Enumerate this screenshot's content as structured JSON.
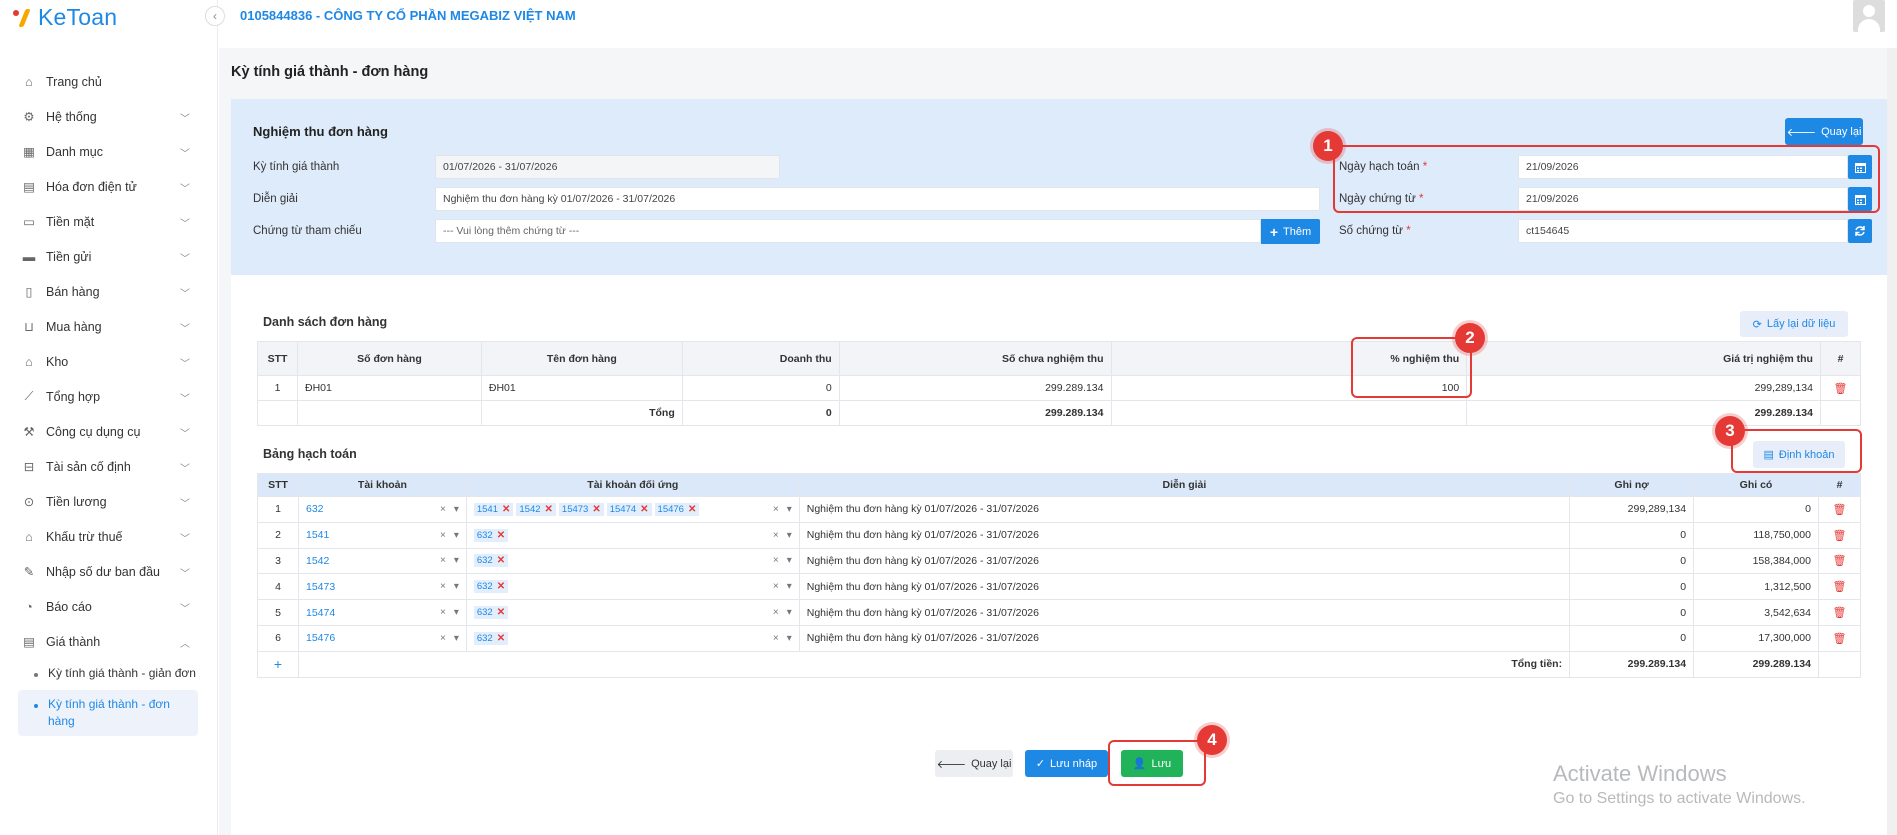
{
  "app": {
    "logo": "KeToan",
    "company": "0105844836 - CÔNG TY CỔ PHẦN MEGABIZ VIỆT NAM"
  },
  "sidebar": {
    "items": [
      {
        "label": "Trang chủ",
        "icon": "home-icon",
        "chevron": false
      },
      {
        "label": "Hệ thống",
        "icon": "gear-icon",
        "chevron": true
      },
      {
        "label": "Danh mục",
        "icon": "grid-icon",
        "chevron": true
      },
      {
        "label": "Hóa đơn điện tử",
        "icon": "invoice-icon",
        "chevron": true
      },
      {
        "label": "Tiền mặt",
        "icon": "cash-icon",
        "chevron": true
      },
      {
        "label": "Tiền gửi",
        "icon": "bank-card-icon",
        "chevron": true
      },
      {
        "label": "Bán hàng",
        "icon": "sales-icon",
        "chevron": true
      },
      {
        "label": "Mua hàng",
        "icon": "cart-icon",
        "chevron": true
      },
      {
        "label": "Kho",
        "icon": "warehouse-icon",
        "chevron": true
      },
      {
        "label": "Tổng hợp",
        "icon": "chart-icon",
        "chevron": true
      },
      {
        "label": "Công cụ dụng cụ",
        "icon": "tools-icon",
        "chevron": true
      },
      {
        "label": "Tài sản cố định",
        "icon": "car-icon",
        "chevron": true
      },
      {
        "label": "Tiền lương",
        "icon": "salary-icon",
        "chevron": true
      },
      {
        "label": "Khấu trừ thuế",
        "icon": "tax-icon",
        "chevron": true
      },
      {
        "label": "Nhập số dư ban đầu",
        "icon": "edit-icon",
        "chevron": true
      },
      {
        "label": "Báo cáo",
        "icon": "report-icon",
        "chevron": true
      },
      {
        "label": "Giá thành",
        "icon": "price-icon",
        "chevron": true
      }
    ],
    "sub_items": [
      {
        "label": "Kỳ tính giá thành - giản đơn"
      },
      {
        "label": "Kỳ tính giá thành - đơn hàng"
      }
    ]
  },
  "page": {
    "title": "Kỳ tính giá thành - đơn hàng"
  },
  "form": {
    "title": "Nghiệm thu đơn hàng",
    "back_button": "Quay lại",
    "period_label": "Kỳ tính giá thành",
    "period_value": "01/07/2026 - 31/07/2026",
    "desc_label": "Diễn giải",
    "desc_value": "Nghiệm thu đơn hàng kỳ 01/07/2026 - 31/07/2026",
    "ref_label": "Chứng từ tham chiếu",
    "ref_placeholder": "--- Vui lòng thêm chứng từ ---",
    "add_button": "Thêm",
    "posting_date_label": "Ngày hạch toán",
    "posting_date_value": "21/09/2026",
    "voucher_date_label": "Ngày chứng từ",
    "voucher_date_value": "21/09/2026",
    "voucher_no_label": "Số chứng từ",
    "voucher_no_value": "ct154645",
    "required_mark": "*"
  },
  "orders": {
    "title": "Danh sách đơn hàng",
    "reload_button": "Lấy lại dữ liệu",
    "headers": [
      "STT",
      "Số đơn hàng",
      "Tên đơn hàng",
      "Doanh thu",
      "Số chưa nghiệm thu",
      "% nghiệm thu",
      "Giá trị nghiệm thu",
      "#"
    ],
    "rows": [
      {
        "stt": "1",
        "code": "ĐH01",
        "name": "ĐH01",
        "revenue": "0",
        "unaccepted": "299.289.134",
        "percent": "100",
        "value": "299,289,134"
      }
    ],
    "total": {
      "label": "Tổng",
      "revenue": "0",
      "unaccepted": "299.289.134",
      "value": "299.289.134"
    }
  },
  "accounting": {
    "title": "Bảng hạch toán",
    "define_button": "Định khoản",
    "headers": [
      "STT",
      "Tài khoản",
      "Tài khoản đối ứng",
      "Diễn giải",
      "Ghi nợ",
      "Ghi có",
      "#"
    ],
    "rows": [
      {
        "stt": "1",
        "account": "632",
        "contra": [
          "1541",
          "1542",
          "15473",
          "15474",
          "15476"
        ],
        "desc": "Nghiệm thu đơn hàng kỳ 01/07/2026 - 31/07/2026",
        "debit": "299,289,134",
        "credit": "0"
      },
      {
        "stt": "2",
        "account": "1541",
        "contra": [
          "632"
        ],
        "desc": "Nghiệm thu đơn hàng kỳ 01/07/2026 - 31/07/2026",
        "debit": "0",
        "credit": "118,750,000"
      },
      {
        "stt": "3",
        "account": "1542",
        "contra": [
          "632"
        ],
        "desc": "Nghiệm thu đơn hàng kỳ 01/07/2026 - 31/07/2026",
        "debit": "0",
        "credit": "158,384,000"
      },
      {
        "stt": "4",
        "account": "15473",
        "contra": [
          "632"
        ],
        "desc": "Nghiệm thu đơn hàng kỳ 01/07/2026 - 31/07/2026",
        "debit": "0",
        "credit": "1,312,500"
      },
      {
        "stt": "5",
        "account": "15474",
        "contra": [
          "632"
        ],
        "desc": "Nghiệm thu đơn hàng kỳ 01/07/2026 - 31/07/2026",
        "debit": "0",
        "credit": "3,542,634"
      },
      {
        "stt": "6",
        "account": "15476",
        "contra": [
          "632"
        ],
        "desc": "Nghiệm thu đơn hàng kỳ 01/07/2026 - 31/07/2026",
        "debit": "0",
        "credit": "17,300,000"
      }
    ],
    "add_row": "+",
    "total": {
      "label": "Tổng tiền:",
      "debit": "299.289.134",
      "credit": "299.289.134"
    }
  },
  "footer": {
    "back": "Quay lại",
    "save_draft": "Lưu nháp",
    "save": "Lưu"
  },
  "annotations": [
    "1",
    "2",
    "3",
    "4"
  ],
  "watermark": {
    "line1": "Activate Windows",
    "line2": "Go to Settings to activate Windows."
  },
  "colors": {
    "primary": "#1e88e5",
    "success": "#21b35a",
    "danger": "#e53935",
    "form_bg": "#deebfb"
  }
}
